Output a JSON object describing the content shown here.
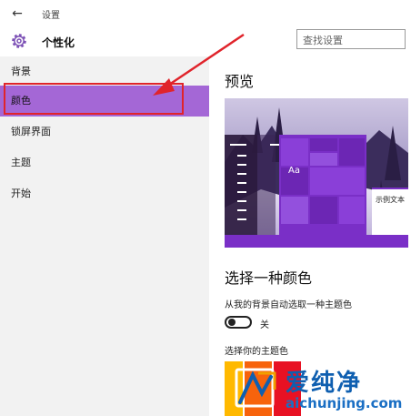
{
  "window": {
    "title": "设置",
    "back_glyph": "←"
  },
  "header": {
    "title": "个性化",
    "icon": "gear-icon",
    "accent_color": "#7b4fb5"
  },
  "search": {
    "placeholder": "查找设置"
  },
  "sidebar": {
    "items": [
      {
        "label": "背景",
        "active": false
      },
      {
        "label": "颜色",
        "active": true
      },
      {
        "label": "锁屏界面",
        "active": false
      },
      {
        "label": "主题",
        "active": false
      },
      {
        "label": "开始",
        "active": false
      }
    ],
    "active_color": "#a467d6",
    "highlight_color": "#e0242b"
  },
  "main": {
    "preview_title": "预览",
    "preview": {
      "tile_text": "Aa",
      "sample_text": "示例文本",
      "accent_color": "#7a2fc7"
    },
    "color_section_title": "选择一种颜色",
    "auto_pick_label": "从我的背景自动选取一种主题色",
    "toggle_state": "关",
    "accent_label": "选择你的主题色"
  },
  "watermark": {
    "text": "爱纯净",
    "url": "aichunjing.com"
  }
}
